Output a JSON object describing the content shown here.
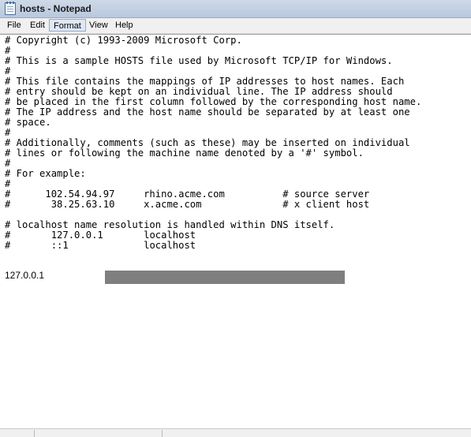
{
  "window": {
    "title": "hosts - Notepad",
    "app_icon": "notepad-icon"
  },
  "menu": {
    "items": [
      "File",
      "Edit",
      "Format",
      "View",
      "Help"
    ],
    "active": "Format"
  },
  "document": {
    "lines": [
      "# Copyright (c) 1993-2009 Microsoft Corp.",
      "#",
      "# This is a sample HOSTS file used by Microsoft TCP/IP for Windows.",
      "#",
      "# This file contains the mappings of IP addresses to host names. Each",
      "# entry should be kept on an individual line. The IP address should",
      "# be placed in the first column followed by the corresponding host name.",
      "# The IP address and the host name should be separated by at least one",
      "# space.",
      "#",
      "# Additionally, comments (such as these) may be inserted on individual",
      "# lines or following the machine name denoted by a '#' symbol.",
      "#",
      "# For example:",
      "#",
      "#      102.54.94.97     rhino.acme.com          # source server",
      "#       38.25.63.10     x.acme.com              # x client host",
      "",
      "# localhost name resolution is handled within DNS itself.",
      "#\t127.0.0.1       localhost",
      "#\t::1             localhost"
    ],
    "custom_entry_ip": "127.0.0.1"
  }
}
